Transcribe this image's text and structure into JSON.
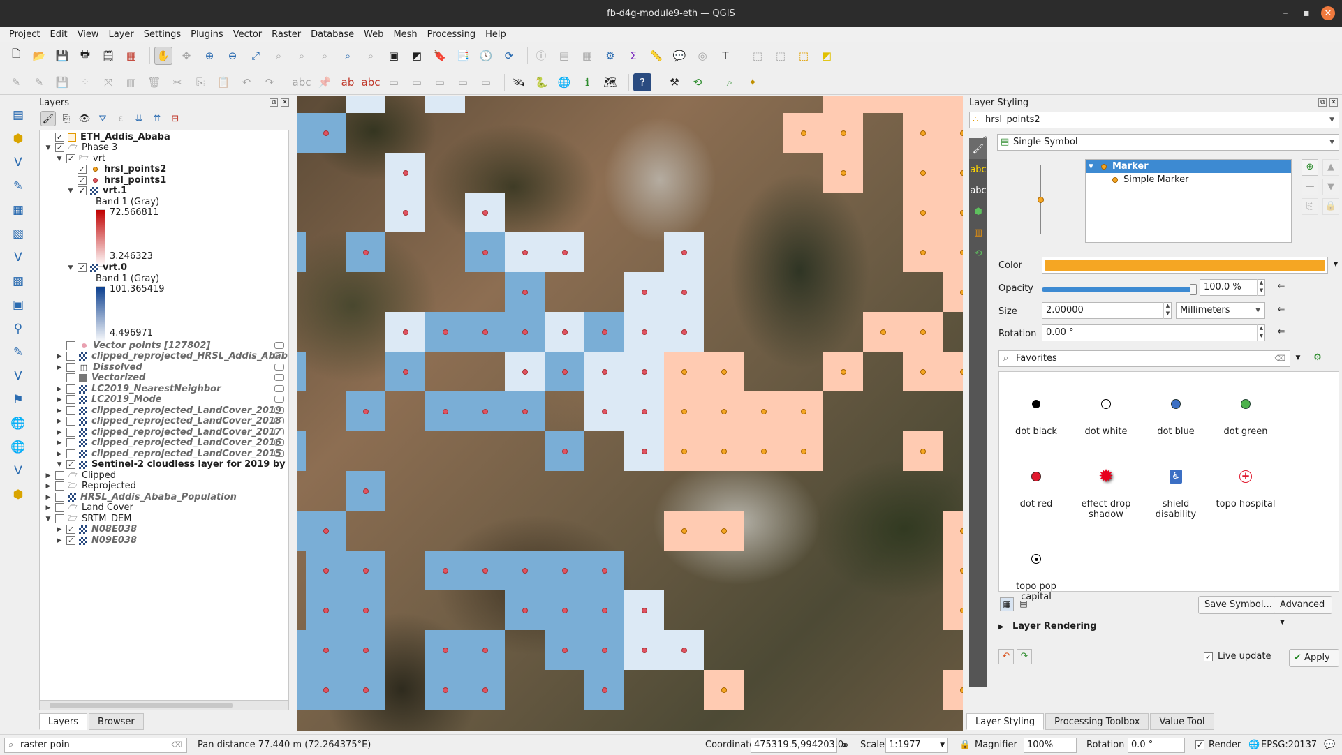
{
  "window": {
    "title": "fb-d4g-module9-eth — QGIS"
  },
  "menu": [
    "Project",
    "Edit",
    "View",
    "Layer",
    "Settings",
    "Plugins",
    "Vector",
    "Raster",
    "Database",
    "Web",
    "Mesh",
    "Processing",
    "Help"
  ],
  "layers_panel": {
    "title": "Layers",
    "tree": [
      {
        "label": "ETH_Addis_Ababa",
        "checked": true
      },
      {
        "label": "Phase 3",
        "checked": true
      },
      {
        "label": "vrt",
        "checked": true
      },
      {
        "label": "hrsl_points2",
        "checked": true
      },
      {
        "label": "hrsl_points1",
        "checked": true
      },
      {
        "label": "vrt.1",
        "checked": true
      },
      {
        "label": "vrt.0",
        "checked": true
      },
      {
        "label": "Vector points [127802]",
        "checked": false
      },
      {
        "label": "clipped_reprojected_HRSL_Addis_Abab",
        "checked": false
      },
      {
        "label": "Dissolved",
        "checked": false
      },
      {
        "label": "Vectorized",
        "checked": false
      },
      {
        "label": "LC2019_NearestNeighbor",
        "checked": false
      },
      {
        "label": "LC2019_Mode",
        "checked": false
      },
      {
        "label": "clipped_reprojected_LandCover_2019",
        "checked": false
      },
      {
        "label": "clipped_reprojected_LandCover_2018",
        "checked": false
      },
      {
        "label": "clipped_reprojected_LandCover_2017",
        "checked": false
      },
      {
        "label": "clipped_reprojected_LandCover_2016",
        "checked": false
      },
      {
        "label": "clipped_reprojected_LandCover_2015",
        "checked": false
      },
      {
        "label": "Sentinel-2 cloudless layer for 2019 by",
        "checked": true
      },
      {
        "label": "Clipped",
        "checked": false
      },
      {
        "label": "Reprojected",
        "checked": false
      },
      {
        "label": "HRSL_Addis_Ababa_Population",
        "checked": false
      },
      {
        "label": "Land Cover",
        "checked": false
      },
      {
        "label": "SRTM_DEM",
        "checked": false
      },
      {
        "label": "N08E038",
        "checked": true
      },
      {
        "label": "N09E038",
        "checked": true
      }
    ],
    "legend_vrt1": {
      "band": "Band 1 (Gray)",
      "max": "72.566811",
      "min": "3.246323",
      "color": "#c00000"
    },
    "legend_vrt0": {
      "band": "Band 1 (Gray)",
      "max": "101.365419",
      "min": "4.496971",
      "color": "#0a3e8e"
    },
    "tabs": [
      "Layers",
      "Browser"
    ]
  },
  "styling": {
    "title": "Layer Styling",
    "layer": "hrsl_points2",
    "renderer": "Single Symbol",
    "symbol_tree": [
      "Marker",
      "Simple Marker"
    ],
    "color_label": "Color",
    "color_value": "#f5a623",
    "opacity_label": "Opacity",
    "opacity_value": "100.0 %",
    "opacity_fraction": 1.0,
    "size_label": "Size",
    "size_value": "2.00000",
    "size_unit": "Millimeters",
    "rotation_label": "Rotation",
    "rotation_value": "0.00 °",
    "search_value": "Favorites",
    "symbols": [
      "dot  black",
      "dot  white",
      "dot blue",
      "dot green",
      "dot red",
      "effect drop shadow",
      "shield disability",
      "topo hospital",
      "topo pop capital"
    ],
    "save_symbol": "Save Symbol...",
    "advanced": "Advanced",
    "layer_rendering": "Layer Rendering",
    "live_update": "Live update",
    "apply": "Apply",
    "tabs": [
      "Layer Styling",
      "Processing Toolbox",
      "Value Tool"
    ]
  },
  "statusbar": {
    "search": "raster poin",
    "message": "Pan distance 77.440 m (72.264375°E)",
    "coordinate_label": "Coordinate",
    "coordinate": "475319.5,994203.0",
    "scale_label": "Scale",
    "scale": "1:1977",
    "magnifier_label": "Magnifier",
    "magnifier": "100%",
    "rotation_label": "Rotation",
    "rotation": "0.0 °",
    "render_label": "Render",
    "crs": "EPSG:20137"
  },
  "map": {
    "palette": {
      "1": "#7aaed6",
      "2": "#dce9f5",
      "3": "#ffcbb2"
    },
    "grid": [
      "0020200000000033333",
      "1100000000000330333",
      "0002000000000030333",
      "0002020000000000333",
      "1010012200200000330",
      "0000001002200000030",
      "0002111212200003303",
      "1001002122330030333",
      "0010111022333300003",
      "1000000102333300303",
      "0010000000000000000",
      "1100000000330000033",
      "0110111110000000033",
      "0110001112000000033",
      "1110110112200000003",
      "1110110010030000033"
    ]
  }
}
